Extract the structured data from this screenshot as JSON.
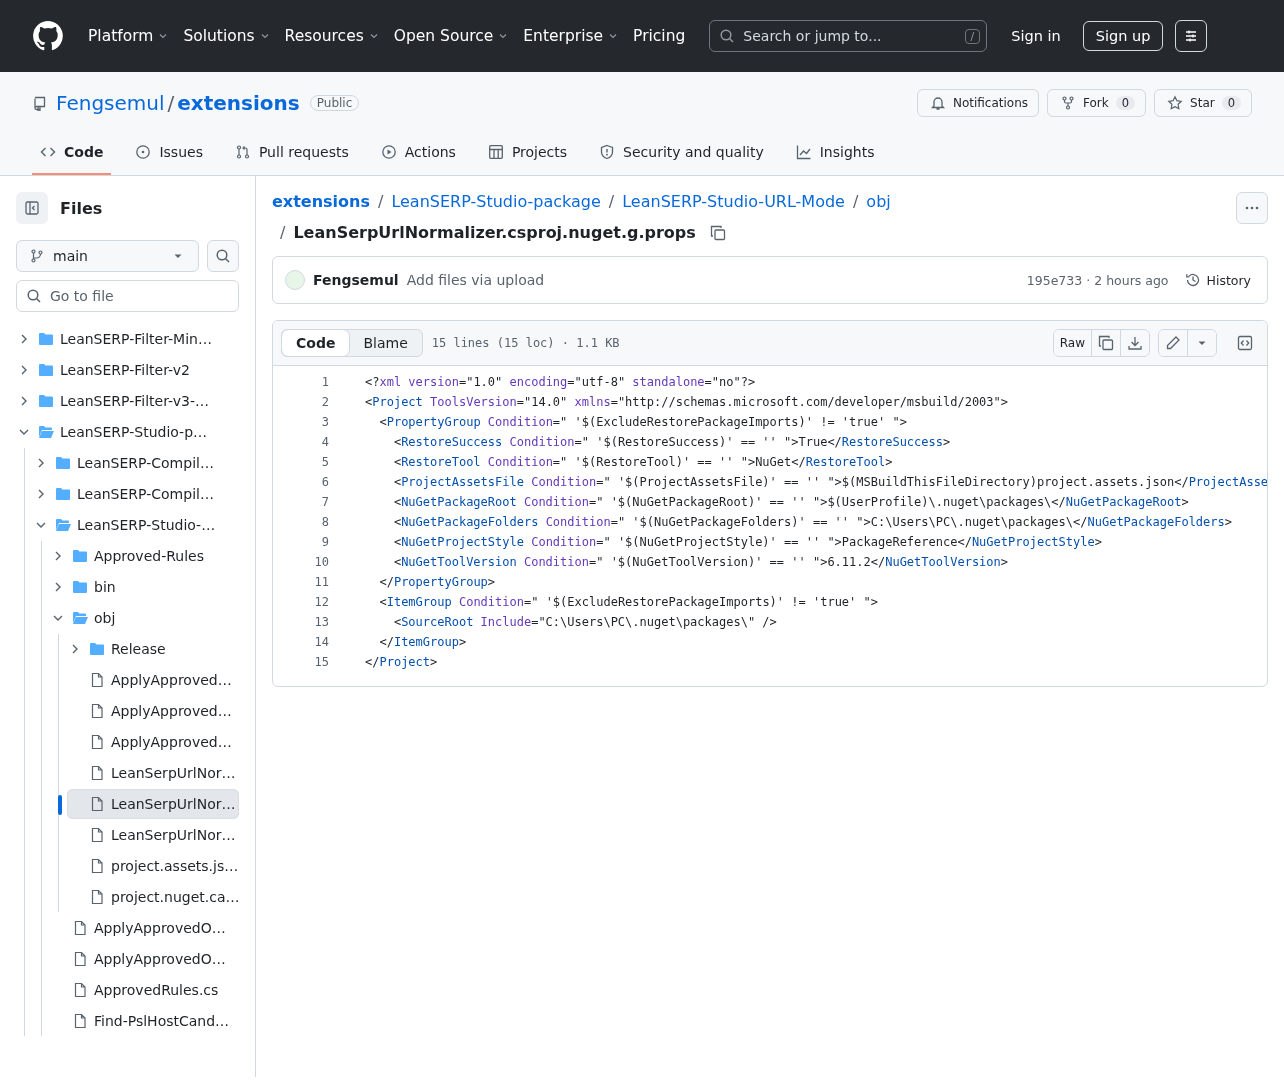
{
  "top_nav": {
    "items": [
      {
        "label": "Platform",
        "has_menu": true
      },
      {
        "label": "Solutions",
        "has_menu": true
      },
      {
        "label": "Resources",
        "has_menu": true
      },
      {
        "label": "Open Source",
        "has_menu": true
      },
      {
        "label": "Enterprise",
        "has_menu": true
      },
      {
        "label": "Pricing",
        "has_menu": false
      }
    ],
    "search": {
      "placeholder": "Search or jump to...",
      "shortcut": "/"
    },
    "sign_in": "Sign in",
    "sign_up": "Sign up"
  },
  "path_separator": "/",
  "repo": {
    "owner": "Fengsemul",
    "name": "extensions",
    "visibility": "Public",
    "actions": [
      {
        "kind": "notifications",
        "label": "Notifications"
      },
      {
        "kind": "fork",
        "label": "Fork",
        "count": "0"
      },
      {
        "kind": "star",
        "label": "Star",
        "count": "0"
      }
    ],
    "tabs": [
      {
        "kind": "code",
        "label": "Code",
        "selected": true
      },
      {
        "kind": "issues",
        "label": "Issues",
        "selected": false
      },
      {
        "kind": "pulls",
        "label": "Pull requests",
        "selected": false
      },
      {
        "kind": "actions",
        "label": "Actions",
        "selected": false
      },
      {
        "kind": "projects",
        "label": "Projects",
        "selected": false
      },
      {
        "kind": "security",
        "label": "Security and quality",
        "selected": false
      },
      {
        "kind": "insights",
        "label": "Insights",
        "selected": false
      }
    ]
  },
  "sidebar": {
    "title": "Files",
    "branch": "main",
    "filter_placeholder": "Go to file",
    "tree": [
      {
        "kind": "folder",
        "name": "LeanSERP-Filter-Min…",
        "expanded": false,
        "selected": false
      },
      {
        "kind": "folder",
        "name": "LeanSERP-Filter-v2",
        "expanded": false,
        "selected": false
      },
      {
        "kind": "folder",
        "name": "LeanSERP-Filter-v3-…",
        "expanded": false,
        "selected": false
      },
      {
        "kind": "folder",
        "name": "LeanSERP-Studio-p…",
        "expanded": true,
        "selected": false,
        "children": [
          {
            "kind": "folder",
            "name": "LeanSERP-Compil…",
            "expanded": false,
            "selected": false
          },
          {
            "kind": "folder",
            "name": "LeanSERP-Compil…",
            "expanded": false,
            "selected": false
          },
          {
            "kind": "folder",
            "name": "LeanSERP-Studio-…",
            "expanded": true,
            "selected": false,
            "children": [
              {
                "kind": "folder",
                "name": "Approved-Rules",
                "expanded": false,
                "selected": false
              },
              {
                "kind": "folder",
                "name": "bin",
                "expanded": false,
                "selected": false
              },
              {
                "kind": "folder",
                "name": "obj",
                "expanded": true,
                "selected": false,
                "children": [
                  {
                    "kind": "folder",
                    "name": "Release",
                    "expanded": false,
                    "selected": false
                  },
                  {
                    "kind": "file",
                    "name": "ApplyApproved…",
                    "selected": false
                  },
                  {
                    "kind": "file",
                    "name": "ApplyApproved…",
                    "selected": false
                  },
                  {
                    "kind": "file",
                    "name": "ApplyApproved…",
                    "selected": false
                  },
                  {
                    "kind": "file",
                    "name": "LeanSerpUrlNor…",
                    "selected": false
                  },
                  {
                    "kind": "file",
                    "name": "LeanSerpUrlNor…",
                    "selected": true
                  },
                  {
                    "kind": "file",
                    "name": "LeanSerpUrlNor…",
                    "selected": false
                  },
                  {
                    "kind": "file",
                    "name": "project.assets.js…",
                    "selected": false
                  },
                  {
                    "kind": "file",
                    "name": "project.nuget.ca…",
                    "selected": false
                  }
                ]
              },
              {
                "kind": "file",
                "name": "ApplyApprovedO…",
                "selected": false
              },
              {
                "kind": "file",
                "name": "ApplyApprovedO…",
                "selected": false
              },
              {
                "kind": "file",
                "name": "ApprovedRules.cs",
                "selected": false
              },
              {
                "kind": "file",
                "name": "Find-PslHostCand…",
                "selected": false
              }
            ]
          }
        ]
      }
    ]
  },
  "breadcrumb": {
    "parts": [
      "extensions",
      "LeanSERP-Studio-package",
      "LeanSERP-Studio-URL-Mode",
      "obj"
    ],
    "file": "LeanSerpUrlNormalizer.csproj.nuget.g.props"
  },
  "commit": {
    "author": "Fengsemul",
    "message": "Add files via upload",
    "hash": "195e733",
    "dot": "·",
    "time": "2 hours ago",
    "history": "History"
  },
  "file_view": {
    "tabs": [
      {
        "label": "Code",
        "selected": true
      },
      {
        "label": "Blame",
        "selected": false
      }
    ],
    "info": "15 lines (15 loc) · 1.1 KB",
    "raw": "Raw",
    "lines": [
      {
        "number": "1",
        "tokens": [
          {
            "kind": "text",
            "text": "<?"
          },
          {
            "kind": "attr",
            "text": "xml"
          },
          {
            "kind": "attr",
            "text": " version"
          },
          {
            "kind": "text",
            "text": "=\"1.0\" "
          },
          {
            "kind": "attr",
            "text": "encoding"
          },
          {
            "kind": "text",
            "text": "=\"utf-8\" "
          },
          {
            "kind": "attr",
            "text": "standalone"
          },
          {
            "kind": "text",
            "text": "=\"no\"?>"
          }
        ]
      },
      {
        "number": "2",
        "tokens": [
          {
            "kind": "text",
            "text": "<"
          },
          {
            "kind": "tag",
            "text": "Project"
          },
          {
            "kind": "attr",
            "text": " ToolsVersion"
          },
          {
            "kind": "text",
            "text": "=\"14.0\" "
          },
          {
            "kind": "attr",
            "text": "xmlns"
          },
          {
            "kind": "text",
            "text": "=\"http://schemas.microsoft.com/developer/msbuild/2003\">"
          }
        ]
      },
      {
        "number": "3",
        "tokens": [
          {
            "kind": "text",
            "text": "  <"
          },
          {
            "kind": "tag",
            "text": "PropertyGroup"
          },
          {
            "kind": "attr",
            "text": " Condition"
          },
          {
            "kind": "text",
            "text": "=\" '$(ExcludeRestorePackageImports)' != 'true' \">"
          }
        ]
      },
      {
        "number": "4",
        "tokens": [
          {
            "kind": "text",
            "text": "    <"
          },
          {
            "kind": "tag",
            "text": "RestoreSuccess"
          },
          {
            "kind": "attr",
            "text": " Condition"
          },
          {
            "kind": "text",
            "text": "=\" '$(RestoreSuccess)' == '' \">True</"
          },
          {
            "kind": "tag",
            "text": "RestoreSuccess"
          },
          {
            "kind": "text",
            "text": ">"
          }
        ]
      },
      {
        "number": "5",
        "tokens": [
          {
            "kind": "text",
            "text": "    <"
          },
          {
            "kind": "tag",
            "text": "RestoreTool"
          },
          {
            "kind": "attr",
            "text": " Condition"
          },
          {
            "kind": "text",
            "text": "=\" '$(RestoreTool)' == '' \">NuGet</"
          },
          {
            "kind": "tag",
            "text": "RestoreTool"
          },
          {
            "kind": "text",
            "text": ">"
          }
        ]
      },
      {
        "number": "6",
        "tokens": [
          {
            "kind": "text",
            "text": "    <"
          },
          {
            "kind": "tag",
            "text": "ProjectAssetsFile"
          },
          {
            "kind": "attr",
            "text": " Condition"
          },
          {
            "kind": "text",
            "text": "=\" '$(ProjectAssetsFile)' == '' \">$(MSBuildThisFileDirectory)project.assets.json</"
          },
          {
            "kind": "tag",
            "text": "ProjectAsse"
          }
        ]
      },
      {
        "number": "7",
        "tokens": [
          {
            "kind": "text",
            "text": "    <"
          },
          {
            "kind": "tag",
            "text": "NuGetPackageRoot"
          },
          {
            "kind": "attr",
            "text": " Condition"
          },
          {
            "kind": "text",
            "text": "=\" '$(NuGetPackageRoot)' == '' \">$(UserProfile)\\.nuget\\packages\\</"
          },
          {
            "kind": "tag",
            "text": "NuGetPackageRoot"
          },
          {
            "kind": "text",
            "text": ">"
          }
        ]
      },
      {
        "number": "8",
        "tokens": [
          {
            "kind": "text",
            "text": "    <"
          },
          {
            "kind": "tag",
            "text": "NuGetPackageFolders"
          },
          {
            "kind": "attr",
            "text": " Condition"
          },
          {
            "kind": "text",
            "text": "=\" '$(NuGetPackageFolders)' == '' \">C:\\Users\\PC\\.nuget\\packages\\</"
          },
          {
            "kind": "tag",
            "text": "NuGetPackageFolders"
          },
          {
            "kind": "text",
            "text": ">"
          }
        ]
      },
      {
        "number": "9",
        "tokens": [
          {
            "kind": "text",
            "text": "    <"
          },
          {
            "kind": "tag",
            "text": "NuGetProjectStyle"
          },
          {
            "kind": "attr",
            "text": " Condition"
          },
          {
            "kind": "text",
            "text": "=\" '$(NuGetProjectStyle)' == '' \">PackageReference</"
          },
          {
            "kind": "tag",
            "text": "NuGetProjectStyle"
          },
          {
            "kind": "text",
            "text": ">"
          }
        ]
      },
      {
        "number": "10",
        "tokens": [
          {
            "kind": "text",
            "text": "    <"
          },
          {
            "kind": "tag",
            "text": "NuGetToolVersion"
          },
          {
            "kind": "attr",
            "text": " Condition"
          },
          {
            "kind": "text",
            "text": "=\" '$(NuGetToolVersion)' == '' \">6.11.2</"
          },
          {
            "kind": "tag",
            "text": "NuGetToolVersion"
          },
          {
            "kind": "text",
            "text": ">"
          }
        ]
      },
      {
        "number": "11",
        "tokens": [
          {
            "kind": "text",
            "text": "  </"
          },
          {
            "kind": "tag",
            "text": "PropertyGroup"
          },
          {
            "kind": "text",
            "text": ">"
          }
        ]
      },
      {
        "number": "12",
        "tokens": [
          {
            "kind": "text",
            "text": "  <"
          },
          {
            "kind": "tag",
            "text": "ItemGroup"
          },
          {
            "kind": "attr",
            "text": " Condition"
          },
          {
            "kind": "text",
            "text": "=\" '$(ExcludeRestorePackageImports)' != 'true' \">"
          }
        ]
      },
      {
        "number": "13",
        "tokens": [
          {
            "kind": "text",
            "text": "    <"
          },
          {
            "kind": "tag",
            "text": "SourceRoot"
          },
          {
            "kind": "attr",
            "text": " Include"
          },
          {
            "kind": "text",
            "text": "=\"C:\\Users\\PC\\.nuget\\packages\\\" />"
          }
        ]
      },
      {
        "number": "14",
        "tokens": [
          {
            "kind": "text",
            "text": "  </"
          },
          {
            "kind": "tag",
            "text": "ItemGroup"
          },
          {
            "kind": "text",
            "text": ">"
          }
        ]
      },
      {
        "number": "15",
        "tokens": [
          {
            "kind": "text",
            "text": "</"
          },
          {
            "kind": "tag",
            "text": "Project"
          },
          {
            "kind": "text",
            "text": ">"
          }
        ]
      }
    ]
  }
}
